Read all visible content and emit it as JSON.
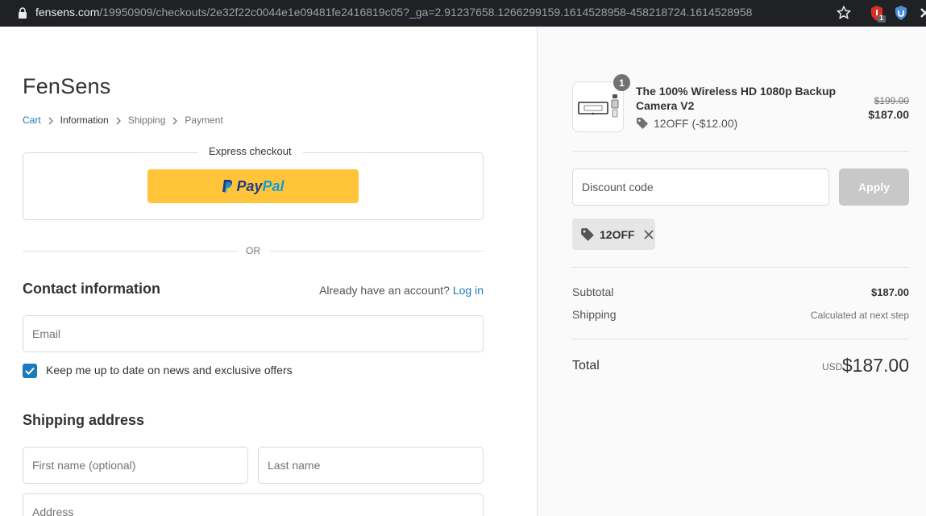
{
  "browser": {
    "url_host": "fensens.com",
    "url_path": "/19950909/checkouts/2e32f22c0044e1e09481fe2416819c05?_ga=2.91237658.1266299159.1614528958-458218724.1614528958",
    "extension_badge": "1"
  },
  "shop": {
    "name": "FenSens"
  },
  "breadcrumb": {
    "cart": "Cart",
    "information": "Information",
    "shipping": "Shipping",
    "payment": "Payment"
  },
  "express": {
    "title": "Express checkout",
    "paypal_pay": "Pay",
    "paypal_pal": "Pal",
    "paypal_color": "#ffc439"
  },
  "divider": {
    "or_text": "OR"
  },
  "contact": {
    "title": "Contact information",
    "account_prompt": "Already have an account?",
    "login_link": "Log in",
    "email_placeholder": "Email",
    "newsletter_label": "Keep me up to date on news and exclusive offers",
    "newsletter_checked": true
  },
  "shipping": {
    "title": "Shipping address",
    "first_name_placeholder": "First name (optional)",
    "last_name_placeholder": "Last name",
    "address_placeholder": "Address"
  },
  "summary": {
    "product": {
      "quantity": "1",
      "name": "The 100% Wireless HD 1080p Backup Camera V2",
      "discount_text": "12OFF (-$12.00)",
      "original_price": "$199.00",
      "price": "$187.00"
    },
    "discount_placeholder": "Discount code",
    "apply_label": "Apply",
    "applied_code": "12OFF",
    "subtotal_label": "Subtotal",
    "subtotal_value": "$187.00",
    "shipping_label": "Shipping",
    "shipping_value": "Calculated at next step",
    "total_label": "Total",
    "total_currency": "USD",
    "total_value": "$187.00"
  },
  "colors": {
    "accent": "#197bbd",
    "browser_bar": "#202124",
    "summary_bg": "#fafafa"
  }
}
